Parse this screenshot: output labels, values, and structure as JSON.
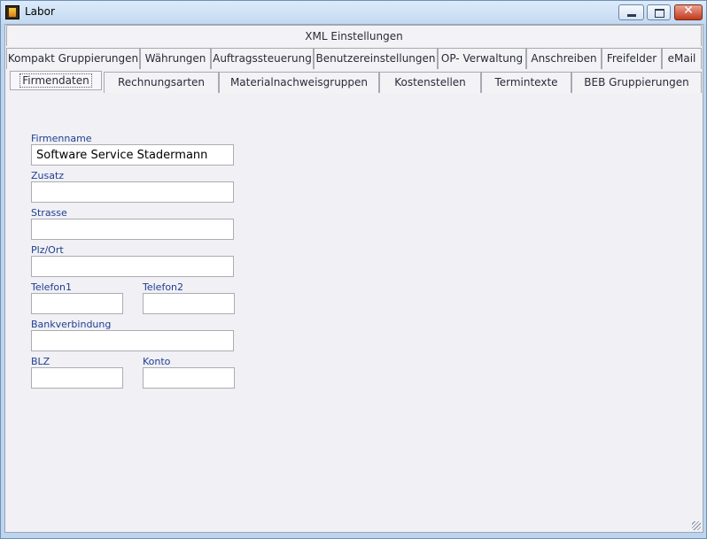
{
  "window": {
    "title": "Labor",
    "close_glyph": "✕"
  },
  "tabs": {
    "top": [
      {
        "label": "XML Einstellungen"
      }
    ],
    "row2": [
      {
        "label": "Kompakt Gruppierungen"
      },
      {
        "label": "Währungen"
      },
      {
        "label": "Auftragssteuerung"
      },
      {
        "label": "Benutzereinstellungen"
      },
      {
        "label": "OP- Verwaltung"
      },
      {
        "label": "Anschreiben"
      },
      {
        "label": "Freifelder"
      },
      {
        "label": "eMail"
      }
    ],
    "row3": [
      {
        "label": "Firmendaten"
      },
      {
        "label": "Rechnungsarten"
      },
      {
        "label": "Materialnachweisgruppen"
      },
      {
        "label": "Kostenstellen"
      },
      {
        "label": "Termintexte"
      },
      {
        "label": "BEB Gruppierungen"
      }
    ],
    "active": "Firmendaten"
  },
  "form": {
    "firmenname": {
      "label": "Firmenname",
      "value": "Software Service Stadermann"
    },
    "zusatz": {
      "label": "Zusatz",
      "value": ""
    },
    "strasse": {
      "label": "Strasse",
      "value": ""
    },
    "plzort": {
      "label": "Plz/Ort",
      "value": ""
    },
    "telefon1": {
      "label": "Telefon1",
      "value": ""
    },
    "telefon2": {
      "label": "Telefon2",
      "value": ""
    },
    "bank": {
      "label": "Bankverbindung",
      "value": ""
    },
    "blz": {
      "label": "BLZ",
      "value": ""
    },
    "konto": {
      "label": "Konto",
      "value": ""
    }
  }
}
